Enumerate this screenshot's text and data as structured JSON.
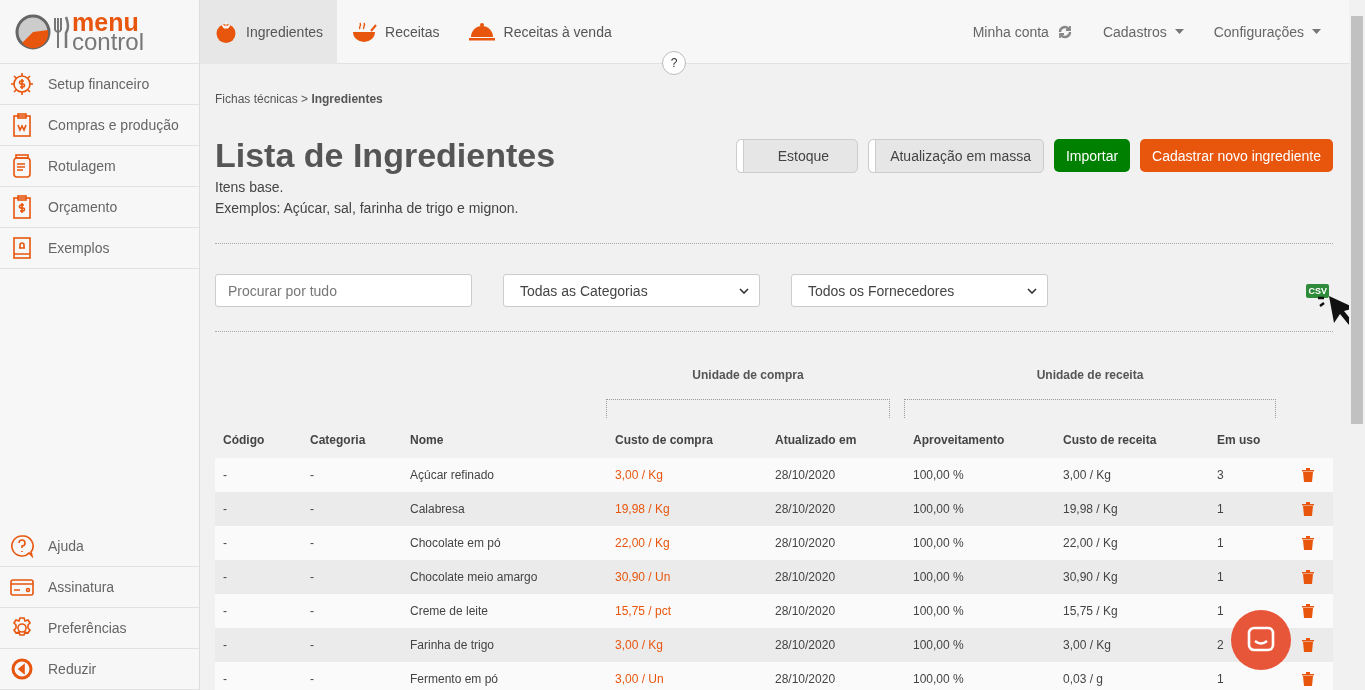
{
  "logo": {
    "line1": "menu",
    "line2": "control"
  },
  "tabs": [
    {
      "label": "Ingredientes",
      "selected": true
    },
    {
      "label": "Receitas",
      "selected": false
    },
    {
      "label": "Receitas à venda",
      "selected": false
    }
  ],
  "top_menu": [
    {
      "label": "Minha conta",
      "kind": "sync"
    },
    {
      "label": "Cadastros",
      "kind": "dropdown"
    },
    {
      "label": "Configurações",
      "kind": "dropdown"
    }
  ],
  "help_badge": "?",
  "sidebar": {
    "items": [
      {
        "label": "Setup financeiro"
      },
      {
        "label": "Compras e produção"
      },
      {
        "label": "Rotulagem"
      },
      {
        "label": "Orçamento"
      },
      {
        "label": "Exemplos"
      }
    ],
    "bottom_items": [
      {
        "label": "Ajuda"
      },
      {
        "label": "Assinatura"
      },
      {
        "label": "Preferências"
      },
      {
        "label": "Reduzir"
      }
    ]
  },
  "breadcrumb": {
    "parent": "Fichas técnicas >",
    "current": "Ingredientes"
  },
  "title": "Lista de Ingredientes",
  "description": [
    "Itens base.",
    "Exemplos: Açúcar, sal, farinha de trigo e mignon."
  ],
  "toggles": [
    {
      "label": "Estoque",
      "on": false
    },
    {
      "label": "Atualização em massa",
      "on": false
    }
  ],
  "buttons": [
    {
      "label": "Importar",
      "kind": "green"
    },
    {
      "label": "Cadastrar novo ingrediente",
      "kind": "orange"
    }
  ],
  "filters": {
    "search_placeholder": "Procurar por tudo",
    "category": "Todas as Categorias",
    "supplier": "Todos os Fornecedores"
  },
  "csv_label": "CSV",
  "table": {
    "groups": [
      "Unidade de compra",
      "Unidade de receita"
    ],
    "columns": [
      "Código",
      "Categoria",
      "Nome",
      "Custo de compra",
      "Atualizado em",
      "Aproveitamento",
      "Custo de receita",
      "Em uso"
    ],
    "rows": [
      [
        "-",
        "-",
        "Açúcar refinado",
        "3,00 / Kg",
        "28/10/2020",
        "100,00 %",
        "3,00 / Kg",
        "3"
      ],
      [
        "-",
        "-",
        "Calabresa",
        "19,98 / Kg",
        "28/10/2020",
        "100,00 %",
        "19,98 / Kg",
        "1"
      ],
      [
        "-",
        "-",
        "Chocolate em pó",
        "22,00 / Kg",
        "28/10/2020",
        "100,00 %",
        "22,00 / Kg",
        "1"
      ],
      [
        "-",
        "-",
        "Chocolate meio amargo",
        "30,90 / Un",
        "28/10/2020",
        "100,00 %",
        "30,90 / Kg",
        "1"
      ],
      [
        "-",
        "-",
        "Creme de leite",
        "15,75 / pct",
        "28/10/2020",
        "100,00 %",
        "15,75 / Kg",
        "1"
      ],
      [
        "-",
        "-",
        "Farinha de trigo",
        "3,00 / Kg",
        "28/10/2020",
        "100,00 %",
        "3,00 / Kg",
        "2"
      ],
      [
        "-",
        "-",
        "Fermento em pó",
        "3,00 / Un",
        "28/10/2020",
        "100,00 %",
        "0,03 / g",
        "1"
      ]
    ]
  }
}
